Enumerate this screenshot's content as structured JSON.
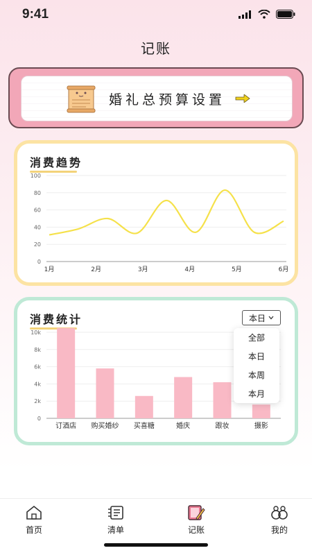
{
  "status": {
    "time": "9:41"
  },
  "nav": {
    "title": "记账"
  },
  "budget": {
    "label": "婚礼总预算设置",
    "icon": "scroll-cat-icon",
    "arrow_color": "#f0d21b"
  },
  "trend": {
    "title": "消费趋势",
    "chart_data": {
      "type": "line",
      "x": [
        "1月",
        "2月",
        "3月",
        "4月",
        "5月",
        "6月"
      ],
      "series": [
        {
          "values": [
            31,
            38,
            50,
            33,
            71,
            34,
            83,
            34,
            47
          ]
        }
      ],
      "yticks": [
        "0",
        "20",
        "40",
        "60",
        "80",
        "100"
      ],
      "ylim": [
        0,
        100
      ],
      "grid": true,
      "color": "#f5e14a"
    }
  },
  "stats": {
    "title": "消费统计",
    "filter": {
      "selected": "本日"
    },
    "menu": [
      "全部",
      "本日",
      "本周",
      "本月"
    ],
    "chart_data": {
      "type": "bar",
      "categories": [
        "订酒店",
        "购买婚纱",
        "买喜糖",
        "婚庆",
        "跟妆",
        "摄影"
      ],
      "values": [
        10500,
        5800,
        2600,
        4800,
        4200,
        1600
      ],
      "yticks": [
        "0",
        "2k",
        "4k",
        "6k",
        "8k",
        "10k"
      ],
      "ylim": [
        0,
        10000
      ],
      "grid": true,
      "color": "#f9b9c5"
    }
  },
  "tabs": [
    {
      "label": "首页",
      "icon": "home-icon"
    },
    {
      "label": "清单",
      "icon": "list-icon"
    },
    {
      "label": "记账",
      "icon": "notebook-pen-icon"
    },
    {
      "label": "我的",
      "icon": "profile-rings-icon"
    }
  ]
}
